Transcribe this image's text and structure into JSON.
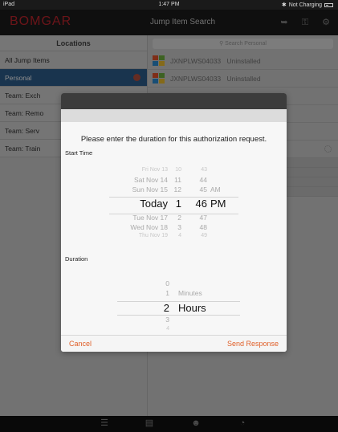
{
  "status_bar": {
    "device": "iPad",
    "time": "1:47 PM",
    "battery": "Not Charging"
  },
  "header": {
    "logo": "BOMGAR",
    "title": "Jump Item Search"
  },
  "left_panel": {
    "title": "Locations",
    "items": [
      {
        "label": "All Jump Items"
      },
      {
        "label": "Personal"
      },
      {
        "label": "Team: Exch"
      },
      {
        "label": "Team: Remo"
      },
      {
        "label": "Team: Serv"
      },
      {
        "label": "Team: Train"
      }
    ]
  },
  "right_panel": {
    "search_placeholder": "Search Personal",
    "rows": [
      {
        "name": "JXNPLWS04033",
        "status": "Uninstalled"
      },
      {
        "name": "JXNPLWS04033",
        "status": "Uninstalled"
      }
    ]
  },
  "dialog": {
    "prompt": "Please enter the duration for this authorization request.",
    "start_label": "Start Time",
    "start_picker": {
      "rows": [
        {
          "day": "Fri Nov 13",
          "hour": "10",
          "minute": "43",
          "ampm": ""
        },
        {
          "day": "Sat Nov 14",
          "hour": "11",
          "minute": "44",
          "ampm": ""
        },
        {
          "day": "Sun Nov 15",
          "hour": "12",
          "minute": "45",
          "ampm": "AM"
        },
        {
          "day": "Today",
          "hour": "1",
          "minute": "46",
          "ampm": "PM"
        },
        {
          "day": "Tue Nov 17",
          "hour": "2",
          "minute": "47",
          "ampm": ""
        },
        {
          "day": "Wed Nov 18",
          "hour": "3",
          "minute": "48",
          "ampm": ""
        },
        {
          "day": "Thu Nov 19",
          "hour": "4",
          "minute": "49",
          "ampm": ""
        }
      ]
    },
    "duration_label": "Duration",
    "duration_picker": {
      "rows": [
        {
          "value": "0",
          "unit": ""
        },
        {
          "value": "1",
          "unit": "Minutes"
        },
        {
          "value": "2",
          "unit": "Hours"
        },
        {
          "value": "3",
          "unit": ""
        },
        {
          "value": "4",
          "unit": ""
        }
      ]
    },
    "cancel_label": "Cancel",
    "send_label": "Send Response"
  },
  "colors": {
    "accent": "#e0602a",
    "brand": "#c4262e",
    "selected": "#2f5f8f"
  }
}
